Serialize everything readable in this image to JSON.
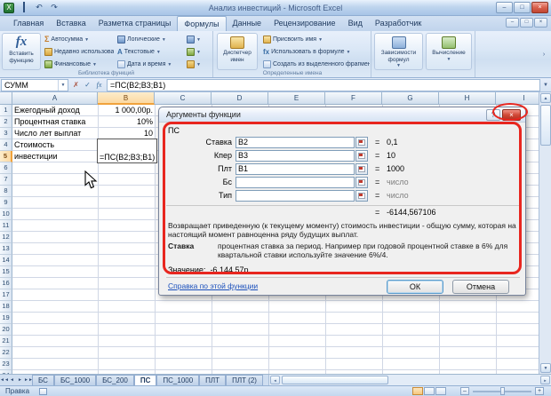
{
  "window": {
    "title": "Анализ инвестиций - Microsoft Excel"
  },
  "ribbon": {
    "tabs": [
      "Главная",
      "Вставка",
      "Разметка страницы",
      "Формулы",
      "Данные",
      "Рецензирование",
      "Вид",
      "Разработчик"
    ],
    "insert_function_label": "Вставить функцию",
    "library": {
      "col1": [
        "Автосумма",
        "Недавно использовались",
        "Финансовые"
      ],
      "col2": [
        "Логические",
        "Текстовые",
        "Дата и время"
      ],
      "group_label": "Библиотека функций"
    },
    "defined_names": {
      "manager_label": "Диспетчер имен",
      "items": [
        "Присвоить имя",
        "Использовать в формуле",
        "Создать из выделенного фрагмента"
      ],
      "group_label": "Определенные имена"
    },
    "audit": {
      "buttons": [
        "Зависимости формул",
        "Вычисление"
      ]
    }
  },
  "formula_bar": {
    "name_box": "СУММ",
    "formula": "=ПС(B2;B3;B1)"
  },
  "grid": {
    "columns": [
      "A",
      "B",
      "C",
      "D",
      "E",
      "F",
      "G",
      "H",
      "I"
    ],
    "row_count": 24,
    "selected_column": "B",
    "selected_row": 5,
    "cells": [
      {
        "row": "1",
        "a": "Ежегодный доход",
        "b": "1 000,00р."
      },
      {
        "row": "2",
        "a": "Процентная ставка",
        "b": "10%"
      },
      {
        "row": "3",
        "a": "Число лет выплат",
        "b": "10"
      },
      {
        "row": "4",
        "a": "Стоимость",
        "b": ""
      },
      {
        "row": "5",
        "a": "инвестиции",
        "b": "=ПС(B2;B3;B1)"
      }
    ]
  },
  "dialog": {
    "title": "Аргументы функции",
    "function_name": "ПС",
    "fields": [
      {
        "label": "Ставка",
        "value": "B2",
        "eq": "=",
        "result": "0,1"
      },
      {
        "label": "Кпер",
        "value": "B3",
        "eq": "=",
        "result": "10"
      },
      {
        "label": "Плт",
        "value": "B1",
        "eq": "=",
        "result": "1000"
      },
      {
        "label": "Бс",
        "value": "",
        "eq": "=",
        "result": "число"
      },
      {
        "label": "Тип",
        "value": "",
        "eq": "=",
        "result": "число"
      }
    ],
    "formula_result_eq": "=",
    "formula_result": "-6144,567106",
    "description": "Возвращает приведенную (к текущему моменту) стоимость инвестиции - общую сумму, которая на настоящий момент равноценна ряду будущих выплат.",
    "arg_name": "Ставка",
    "arg_description": "процентная ставка за период. Например при годовой процентной ставке в 6% для квартальной ставки используйте значение 6%/4.",
    "value_label": "Значение:",
    "value": "-6 144,57р.",
    "help_link": "Справка по этой функции",
    "ok_label": "ОК",
    "cancel_label": "Отмена"
  },
  "sheets": {
    "tabs": [
      "БС",
      "БС_1000",
      "БС_200",
      "ПС",
      "ПС_1000",
      "ПЛТ",
      "ПЛТ (2)"
    ],
    "active": "ПС"
  },
  "status_bar": {
    "mode": "Правка"
  },
  "accent_colors": {
    "annotation_red": "#e8261f",
    "selection_orange": "#fbd9a2"
  }
}
